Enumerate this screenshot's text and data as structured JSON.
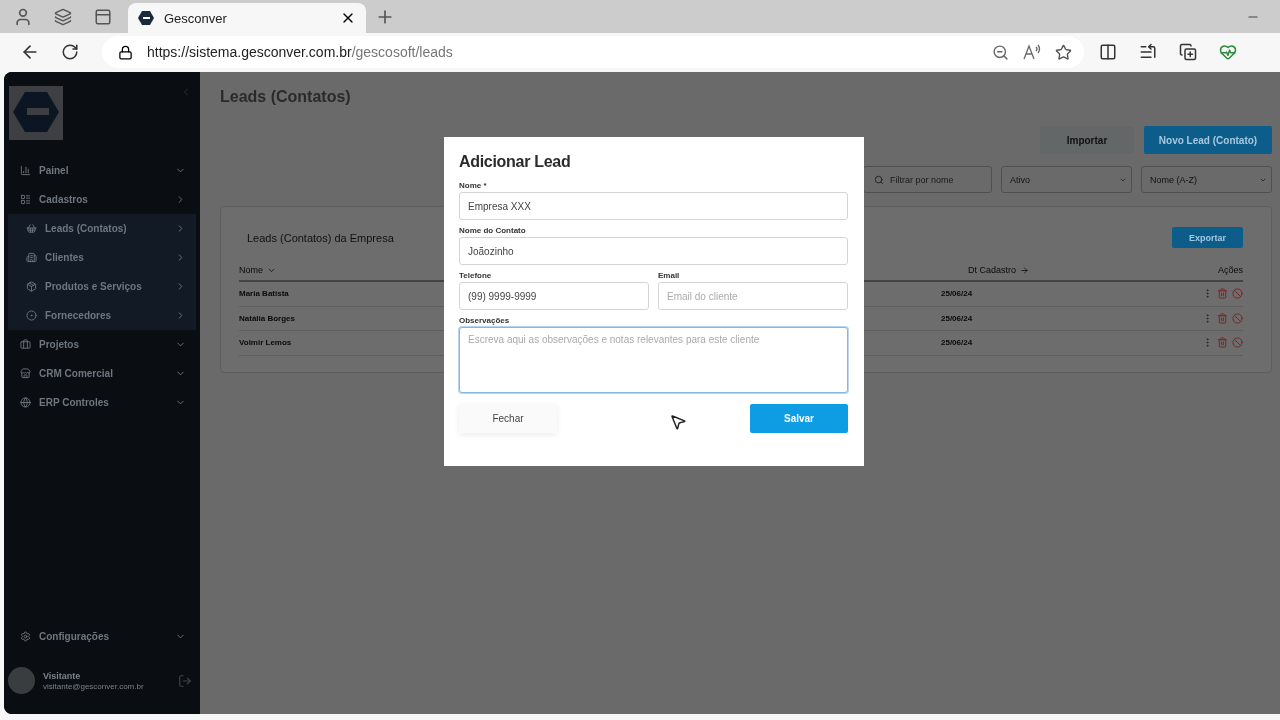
{
  "browser": {
    "tab_title": "Gesconver",
    "url_host": "https://sistema.gesconver.com.br",
    "url_path": "/gescosoft/leads"
  },
  "sidebar": {
    "items": [
      {
        "label": "Painel",
        "expanded": false
      },
      {
        "label": "Cadastros",
        "expanded": true,
        "children": [
          {
            "label": "Leads (Contatos)"
          },
          {
            "label": "Clientes"
          },
          {
            "label": "Produtos e Serviços"
          },
          {
            "label": "Fornecedores"
          }
        ]
      },
      {
        "label": "Projetos",
        "expanded": false
      },
      {
        "label": "CRM Comercial",
        "expanded": false
      },
      {
        "label": "ERP Controles",
        "expanded": false
      }
    ],
    "settings": "Configurações",
    "user": {
      "name": "Visitante",
      "email": "visitante@gesconver.com.br"
    }
  },
  "page": {
    "title": "Leads (Contatos)",
    "buttons": [
      {
        "label": "Importar",
        "kind": "secondary"
      },
      {
        "label": "Novo Lead (Contato)",
        "kind": "primary"
      }
    ],
    "filter": {
      "placeholder": "Filtrar por nome"
    },
    "status_select": "Ativo",
    "sort_select": "Nome (A-Z)",
    "card_title": "Leads (Contatos) da Empresa",
    "export_button": "Exportar",
    "columns": [
      "Nome",
      "Dt Cadastro",
      "Ações"
    ],
    "rows": [
      {
        "name": "Maria Batista",
        "date": "25/06/24"
      },
      {
        "name": "Natália Borges",
        "date": "25/06/24"
      },
      {
        "name": "Volmir Lemos",
        "date": "25/06/24"
      }
    ]
  },
  "modal": {
    "title": "Adicionar Lead",
    "rows": [
      {
        "fields": [
          {
            "label": "Nome *",
            "value": "Empresa XXX",
            "kind": "input",
            "focused": false
          }
        ]
      },
      {
        "fields": [
          {
            "label": "Nome do Contato",
            "value": "Joãozinho",
            "kind": "input",
            "focused": false
          }
        ]
      },
      {
        "fields": [
          {
            "label": "Telefone",
            "value": "(99) 9999-9999",
            "kind": "input",
            "focused": false
          },
          {
            "label": "Email",
            "placeholder": "Email do cliente",
            "kind": "input",
            "focused": false
          }
        ]
      },
      {
        "fields": [
          {
            "label": "Observações",
            "placeholder": "Escreva aqui as observações e notas relevantes para este cliente",
            "kind": "textarea",
            "focused": true
          }
        ]
      }
    ],
    "buttons": [
      {
        "label": "Fechar",
        "kind": "secondary"
      },
      {
        "label": "Salvar",
        "kind": "primary"
      }
    ]
  }
}
